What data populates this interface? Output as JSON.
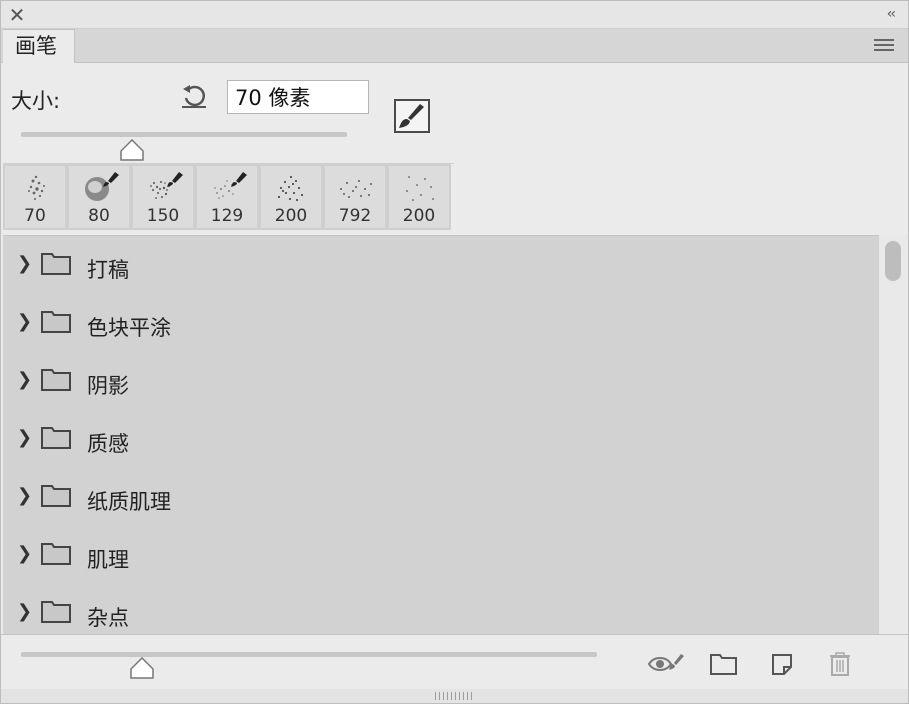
{
  "window": {
    "close_glyph": "✕",
    "collapse_glyph": "‹‹"
  },
  "tab": {
    "label": "画笔"
  },
  "size": {
    "label": "大小:",
    "value": "70 像素",
    "slider_fraction": 0.34
  },
  "presets": [
    {
      "size": "70",
      "icon": "soft-charcoal-brush-icon"
    },
    {
      "size": "80",
      "icon": "smudge-brush-icon"
    },
    {
      "size": "150",
      "icon": "spatter-brush-icon"
    },
    {
      "size": "129",
      "icon": "dry-spatter-brush-icon"
    },
    {
      "size": "200",
      "icon": "scatter-dots-brush-icon"
    },
    {
      "size": "792",
      "icon": "sparse-dots-brush-icon"
    },
    {
      "size": "200",
      "icon": "fine-dots-brush-icon"
    }
  ],
  "groups": [
    {
      "label": "打稿"
    },
    {
      "label": "色块平涂"
    },
    {
      "label": "阴影"
    },
    {
      "label": "质感"
    },
    {
      "label": "纸质肌理"
    },
    {
      "label": "肌理"
    },
    {
      "label": "杂点"
    }
  ],
  "bottom": {
    "preview_slider_fraction": 0.21,
    "icons": [
      "toggle-preview-icon",
      "new-group-icon",
      "new-brush-icon",
      "trash-icon"
    ]
  },
  "colors": {
    "panel_bg": "#ebebeb",
    "list_bg": "#d2d2d2",
    "tab_bar": "#d6d6d6"
  }
}
